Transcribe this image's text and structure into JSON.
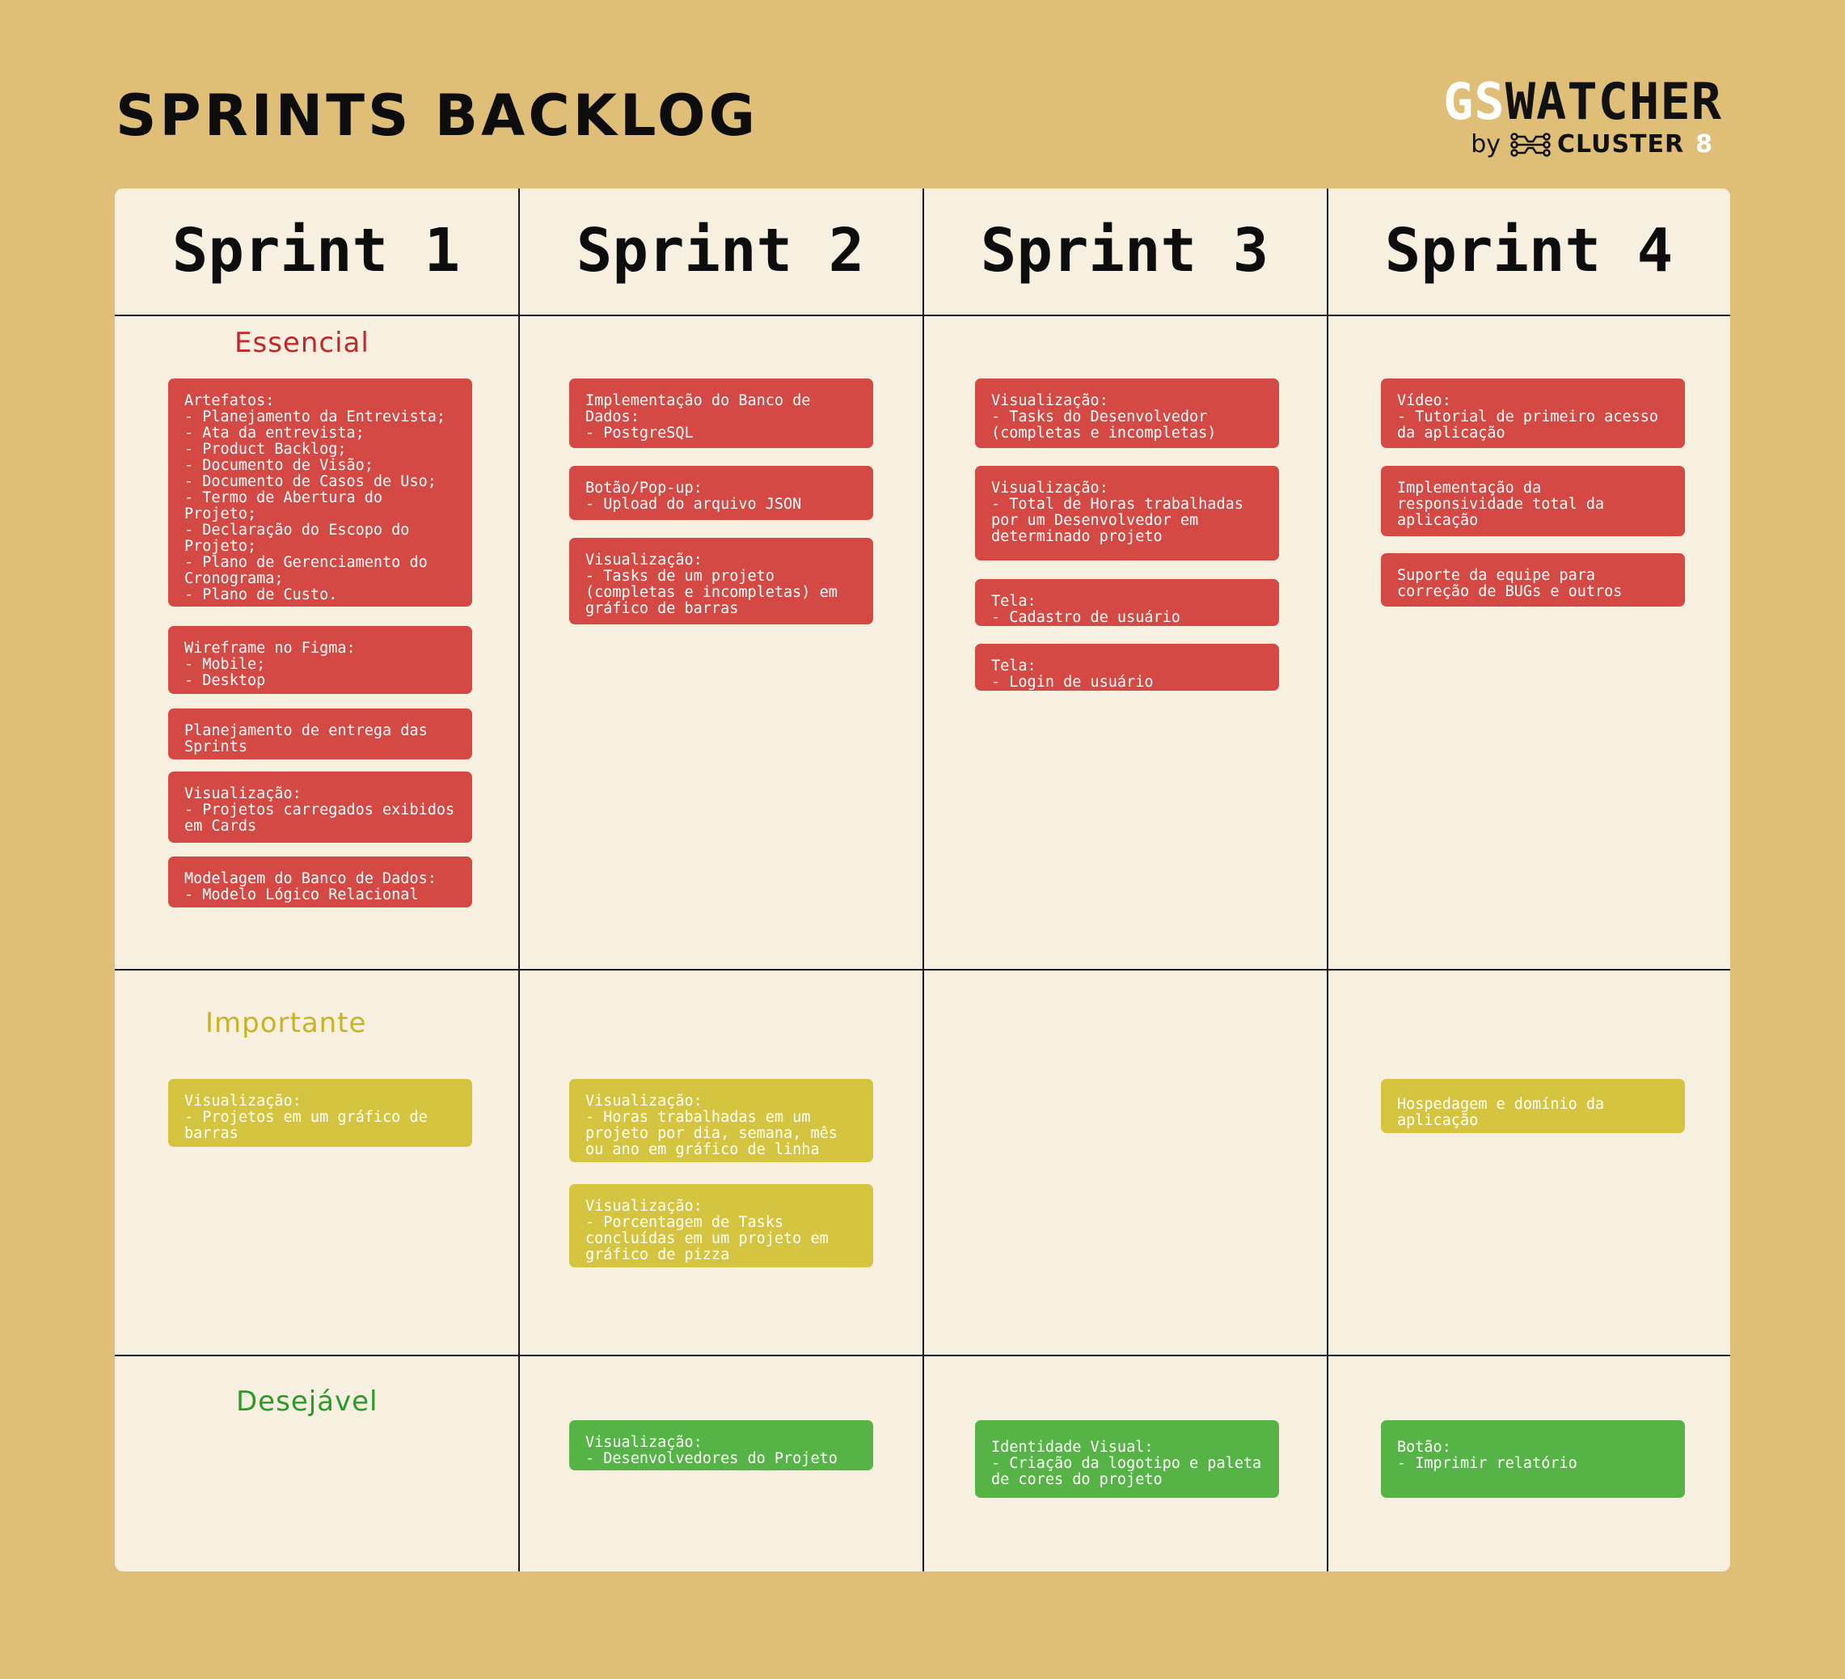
{
  "header": {
    "title": "SPRINTS BACKLOG",
    "logo_gs": "GS",
    "logo_rest": "WATCHER",
    "logo_by": "by",
    "logo_cluster": "CLUSTER",
    "logo_num": "8"
  },
  "sprints": [
    "Sprint 1",
    "Sprint 2",
    "Sprint 3",
    "Sprint 4"
  ],
  "priorities": {
    "essencial": "Essencial",
    "importante": "Importante",
    "desejavel": "Desejável"
  },
  "colors": {
    "background": "#dfbe77",
    "board": "#f7efe0",
    "essencial": "#d54945",
    "importante": "#d4c43f",
    "desejavel": "#56b446"
  },
  "cards": {
    "s1_e1": "Artefatos:\n- Planejamento da Entrevista;\n- Ata da entrevista;\n- Product Backlog;\n- Documento de Visão;\n- Documento de Casos de Uso;\n- Termo de Abertura do Projeto;\n- Declaração do Escopo do Projeto;\n- Plano de Gerenciamento do Cronograma;\n- Plano de Custo.",
    "s1_e2": "Wireframe no Figma:\n- Mobile;\n- Desktop",
    "s1_e3": "Planejamento de entrega das Sprints",
    "s1_e4": "Visualização:\n- Projetos carregados exibidos em Cards",
    "s1_e5": "Modelagem do Banco de Dados:\n- Modelo Lógico Relacional",
    "s2_e1": "Implementação do Banco de Dados:\n- PostgreSQL",
    "s2_e2": "Botão/Pop-up:\n- Upload do arquivo JSON",
    "s2_e3": "Visualização:\n- Tasks de um projeto (completas e incompletas) em gráfico de barras",
    "s3_e1": "Visualização:\n- Tasks do Desenvolvedor (completas e incompletas)",
    "s3_e2": "Visualização:\n- Total de Horas trabalhadas por um Desenvolvedor em determinado projeto",
    "s3_e3": "Tela:\n- Cadastro de usuário",
    "s3_e4": "Tela:\n- Login de usuário",
    "s4_e1": "Vídeo:\n- Tutorial de primeiro acesso da aplicação",
    "s4_e2": "Implementação da responsividade total da aplicação",
    "s4_e3": "Suporte da equipe para correção de BUGs e outros",
    "s1_i1": "Visualização:\n- Projetos em um gráfico de barras",
    "s2_i1": "Visualização:\n- Horas trabalhadas em um projeto por dia, semana, mês ou ano em gráfico de linha",
    "s2_i2": "Visualização:\n- Porcentagem de Tasks concluídas em um projeto em gráfico de pizza",
    "s4_i1": "Hospedagem e domínio da aplicação",
    "s2_d1": "Visualização:\n- Desenvolvedores do Projeto",
    "s3_d1": "Identidade Visual:\n- Criação da logotipo e paleta de cores do projeto",
    "s4_d1": "Botão:\n- Imprimir relatório"
  }
}
